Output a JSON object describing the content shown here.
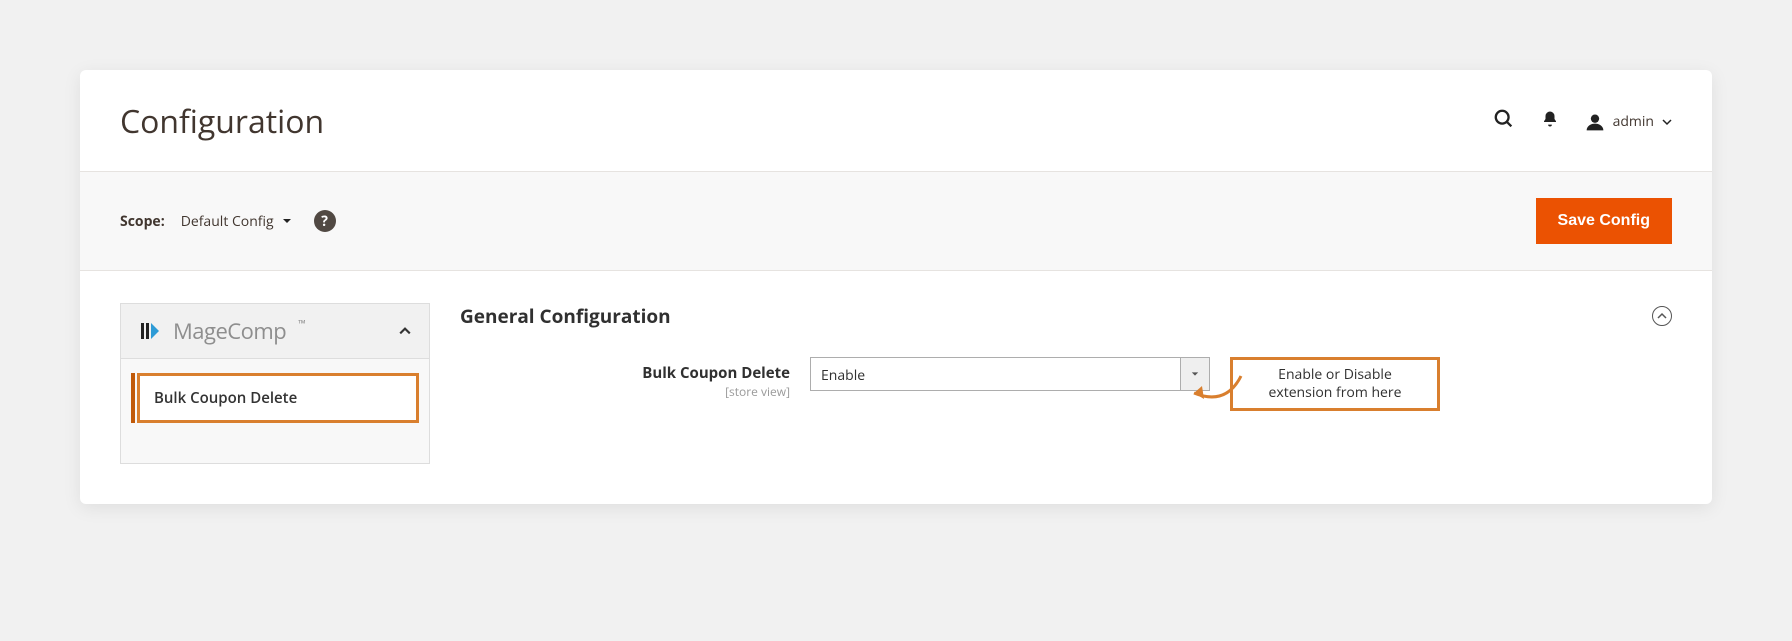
{
  "header": {
    "title": "Configuration",
    "user": "admin"
  },
  "toolbar": {
    "scope_label": "Scope:",
    "scope_value": "Default Config",
    "save_label": "Save Config"
  },
  "sidebar": {
    "brand": "MageComp",
    "items": [
      {
        "label": "Bulk Coupon Delete"
      }
    ]
  },
  "main": {
    "section_title": "General Configuration",
    "field": {
      "label": "Bulk Coupon Delete",
      "scope": "[store view]",
      "value": "Enable"
    },
    "callout": "Enable or Disable extension from here"
  }
}
